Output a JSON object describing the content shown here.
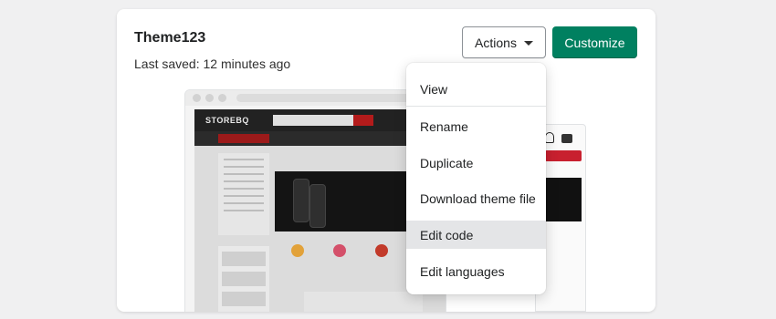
{
  "theme": {
    "name": "Theme123",
    "last_saved": "Last saved: 12 minutes ago"
  },
  "buttons": {
    "actions_label": "Actions",
    "customize_label": "Customize"
  },
  "preview": {
    "store_logo": "STOREBQ"
  },
  "actions_menu": {
    "items": [
      {
        "label": "View"
      },
      {
        "label": "Rename"
      },
      {
        "label": "Duplicate"
      },
      {
        "label": "Download theme file"
      },
      {
        "label": "Edit code",
        "highlighted": true
      },
      {
        "label": "Edit languages"
      }
    ]
  },
  "colors": {
    "primary": "#008060",
    "store_accent": "#b31b1b",
    "menu_highlight": "#e4e5e7"
  }
}
